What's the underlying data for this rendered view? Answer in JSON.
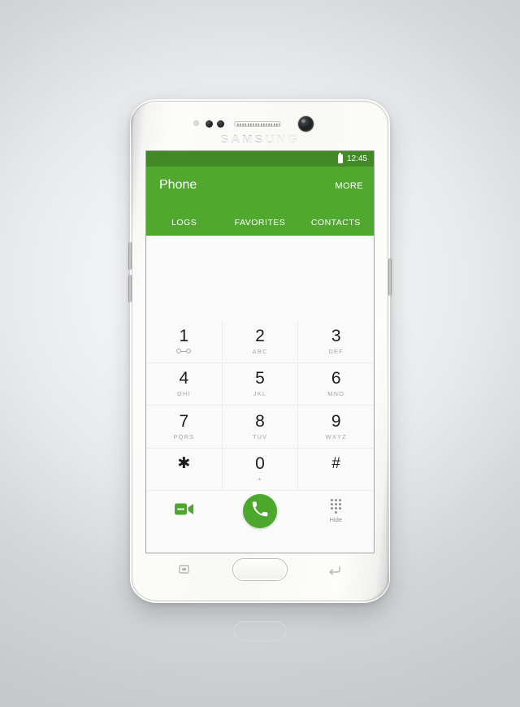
{
  "device": {
    "brand": "SAMSUNG",
    "hardware": {
      "proximity_sensor": "proximity-sensor",
      "front_camera": "front-camera-icon",
      "earpiece": "earpiece-speaker",
      "home_button": "home-button",
      "recents_button": "recent-apps-icon",
      "back_button": "back-icon",
      "volume_up": "volume-up-button",
      "volume_down": "volume-down-button",
      "power": "power-button"
    }
  },
  "colors": {
    "accent_green": "#51a82e",
    "status_green": "#428a28",
    "call_green": "#4ca82c",
    "screen_bg": "#fafafa",
    "key_label": "#a6a6a6"
  },
  "screen": {
    "statusbar": {
      "time": "12:45",
      "battery_icon": "battery-icon"
    },
    "appbar": {
      "title": "Phone",
      "more_label": "MORE"
    },
    "tabs": [
      {
        "label": "LOGS",
        "name": "tab-logs"
      },
      {
        "label": "FAVORITES",
        "name": "tab-favorites"
      },
      {
        "label": "CONTACTS",
        "name": "tab-contacts"
      }
    ],
    "number_display": {
      "value": "",
      "placeholder": ""
    },
    "keypad": {
      "rows": [
        [
          {
            "digit": "1",
            "sub": "",
            "icon": "voicemail-icon"
          },
          {
            "digit": "2",
            "sub": "ABC",
            "icon": ""
          },
          {
            "digit": "3",
            "sub": "DEF",
            "icon": ""
          }
        ],
        [
          {
            "digit": "4",
            "sub": "GHI",
            "icon": ""
          },
          {
            "digit": "5",
            "sub": "JKL",
            "icon": ""
          },
          {
            "digit": "6",
            "sub": "MNO",
            "icon": ""
          }
        ],
        [
          {
            "digit": "7",
            "sub": "PQRS",
            "icon": ""
          },
          {
            "digit": "8",
            "sub": "TUV",
            "icon": ""
          },
          {
            "digit": "9",
            "sub": "WXYZ",
            "icon": ""
          }
        ],
        [
          {
            "digit": "✱",
            "sub": "",
            "icon": ""
          },
          {
            "digit": "0",
            "sub": "+",
            "icon": ""
          },
          {
            "digit": "#",
            "sub": "",
            "icon": ""
          }
        ]
      ]
    },
    "actions": {
      "video_call": {
        "label": "",
        "icon": "video-call-icon"
      },
      "call": {
        "label": "",
        "icon": "call-icon"
      },
      "hide": {
        "label": "Hide",
        "icon": "keypad-icon"
      }
    }
  }
}
